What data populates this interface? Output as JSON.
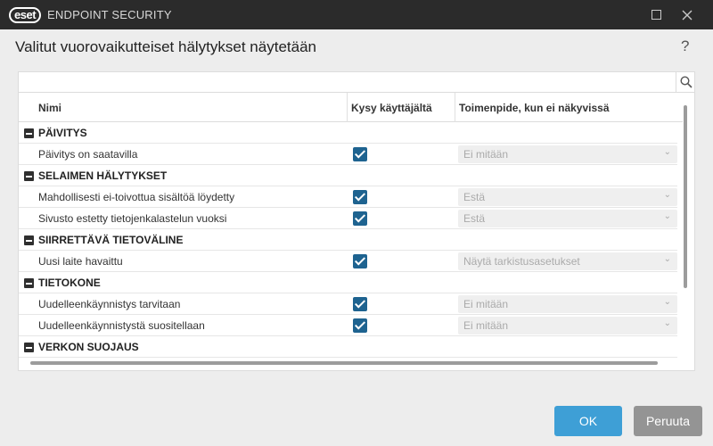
{
  "window": {
    "logo_text": "eset",
    "app_name": "ENDPOINT SECURITY"
  },
  "dialog": {
    "title": "Valitut vuorovaikutteiset hälytykset näytetään",
    "help": "?"
  },
  "table": {
    "headers": {
      "name": "Nimi",
      "ask_user": "Kysy käyttäjältä",
      "action": "Toimenpide, kun ei näkyvissä"
    },
    "rows": [
      {
        "type": "group",
        "label": "PÄIVITYS"
      },
      {
        "type": "item",
        "label": "Päivitys on saatavilla",
        "checked": true,
        "action": "Ei mitään"
      },
      {
        "type": "group",
        "label": "SELAIMEN HÄLYTYKSET"
      },
      {
        "type": "item",
        "label": "Mahdollisesti ei-toivottua sisältöä löydetty",
        "checked": true,
        "action": "Estä"
      },
      {
        "type": "item",
        "label": "Sivusto estetty tietojenkalastelun vuoksi",
        "checked": true,
        "action": "Estä"
      },
      {
        "type": "group",
        "label": "SIIRRETTÄVÄ TIETOVÄLINE"
      },
      {
        "type": "item",
        "label": "Uusi laite havaittu",
        "checked": true,
        "action": "Näytä tarkistusasetukset"
      },
      {
        "type": "group",
        "label": "TIETOKONE"
      },
      {
        "type": "item",
        "label": "Uudelleenkäynnistys tarvitaan",
        "checked": true,
        "action": "Ei mitään"
      },
      {
        "type": "item",
        "label": "Uudelleenkäynnistystä suositellaan",
        "checked": true,
        "action": "Ei mitään"
      },
      {
        "type": "group",
        "label": "VERKON SUOJAUS"
      }
    ]
  },
  "buttons": {
    "ok": "OK",
    "cancel": "Peruuta"
  },
  "colors": {
    "titlebar": "#2b2b2b",
    "checkbox": "#1e6390",
    "ok_button": "#3e9fd6",
    "cancel_button": "#949494"
  }
}
